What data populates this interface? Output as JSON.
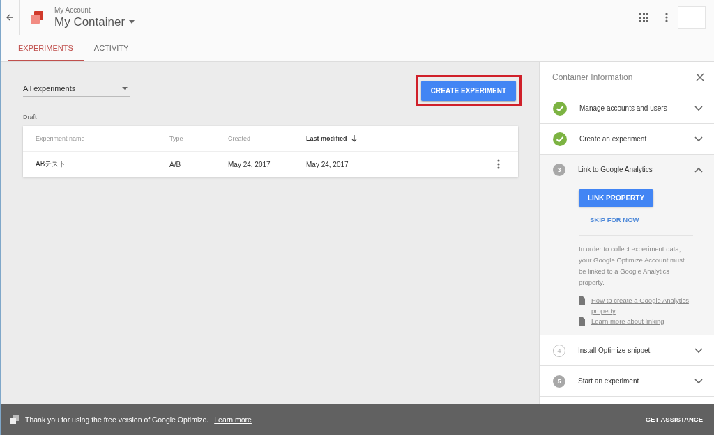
{
  "header": {
    "account": "My Account",
    "container": "My Container"
  },
  "tabs": [
    {
      "label": "EXPERIMENTS",
      "selected": true
    },
    {
      "label": "ACTIVITY",
      "selected": false
    }
  ],
  "filter": {
    "value": "All experiments"
  },
  "create_button": "CREATE EXPERIMENT",
  "section_title": "Draft",
  "table": {
    "columns": [
      {
        "label": "Experiment name",
        "sorted": false
      },
      {
        "label": "Type",
        "sorted": false
      },
      {
        "label": "Created",
        "sorted": false
      },
      {
        "label": "Last modified",
        "sorted": true
      }
    ],
    "rows": [
      [
        "ABテスト",
        "A/B",
        "May 24, 2017",
        "May 24, 2017"
      ]
    ]
  },
  "panel": {
    "title": "Container Information",
    "steps": [
      {
        "label": "Manage accounts and users",
        "kind": "done",
        "expanded": false
      },
      {
        "label": "Create an experiment",
        "kind": "done",
        "expanded": false
      },
      {
        "number": "3",
        "label": "Link to Google Analytics",
        "kind": "current",
        "expanded": true,
        "primary": "LINK PROPERTY",
        "secondary": "SKIP FOR NOW",
        "text": "In order to collect experiment data, your Google Optimize Account must be linked to a Google Analytics property.",
        "links": [
          "How to create a Google Analytics property",
          "Learn more about linking"
        ]
      },
      {
        "number": "4",
        "label": "Install Optimize snippet",
        "kind": "outline",
        "expanded": false
      },
      {
        "number": "5",
        "label": "Start an experiment",
        "kind": "filled",
        "expanded": false
      }
    ]
  },
  "footer": {
    "message": "Thank you for using the free version of Google Optimize.",
    "link": "Learn more",
    "action": "GET ASSISTANCE"
  }
}
